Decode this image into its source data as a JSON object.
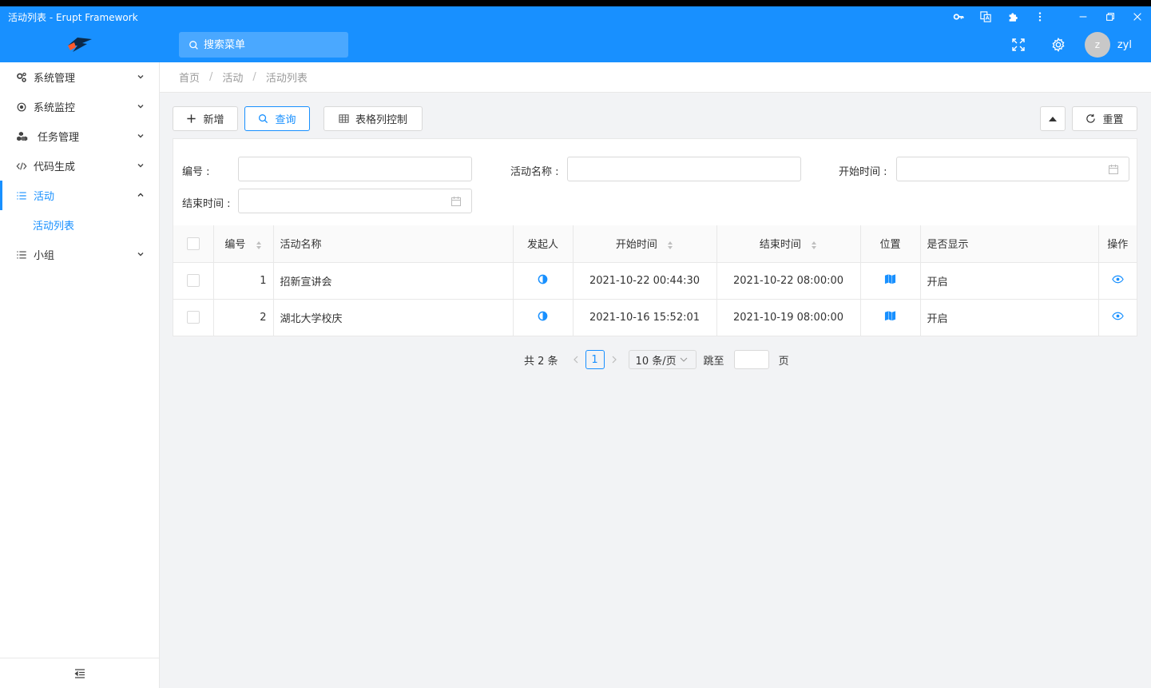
{
  "window": {
    "title": "活动列表 - Erupt Framework"
  },
  "header": {
    "search_placeholder": "搜索菜单",
    "username": "zyl",
    "avatar_letter": "z"
  },
  "sidebar": {
    "items": [
      {
        "label": "系统管理",
        "icon": "cogs-icon"
      },
      {
        "label": "系统监控",
        "icon": "target-icon"
      },
      {
        "label": "任务管理",
        "icon": "cubes-icon"
      },
      {
        "label": "代码生成",
        "icon": "code-icon"
      },
      {
        "label": "活动",
        "icon": "list-icon"
      },
      {
        "label": "活动列表",
        "icon": ""
      },
      {
        "label": "小组",
        "icon": "list-icon"
      }
    ]
  },
  "breadcrumb": {
    "home": "首页",
    "parent": "活动",
    "current": "活动列表"
  },
  "toolbar": {
    "add_label": "新增",
    "query_label": "查询",
    "columns_label": "表格列控制",
    "reset_label": "重置"
  },
  "search_form": {
    "id_label": "编号 :",
    "name_label": "活动名称 :",
    "start_label": "开始时间 :",
    "end_label": "结束时间 :"
  },
  "table": {
    "headers": [
      "编号",
      "活动名称",
      "发起人",
      "开始时间",
      "结束时间",
      "位置",
      "是否显示",
      "操作"
    ],
    "rows": [
      {
        "id": "1",
        "name": "招新宣讲会",
        "start": "2021-10-22 00:44:30",
        "end": "2021-10-22 08:00:00",
        "show": "开启"
      },
      {
        "id": "2",
        "name": "湖北大学校庆",
        "start": "2021-10-16 15:52:01",
        "end": "2021-10-19 08:00:00",
        "show": "开启"
      }
    ]
  },
  "pagination": {
    "total": "共 2 条",
    "current": "1",
    "page_size": "10 条/页",
    "jump_label": "跳至",
    "page_suffix": "页"
  },
  "colors": {
    "primary": "#1890ff"
  }
}
